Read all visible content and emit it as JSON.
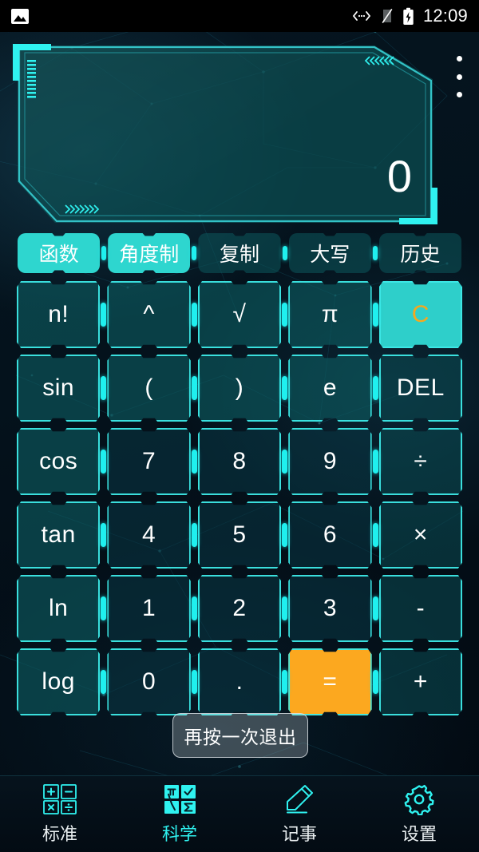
{
  "status_bar": {
    "left_icon": "image-icon",
    "icons": [
      "cast-icon",
      "no-sim-icon",
      "battery-charging-icon"
    ],
    "time": "12:09"
  },
  "display": {
    "value": "0",
    "menu_icon": "overflow-menu-icon",
    "decor": {
      "chevrons_top_right": "《《《",
      "chevrons_bottom_left": "》》》"
    }
  },
  "function_bar": [
    {
      "label": "函数",
      "active": true
    },
    {
      "label": "角度制",
      "active": true
    },
    {
      "label": "复制",
      "active": false
    },
    {
      "label": "大写",
      "active": false
    },
    {
      "label": "历史",
      "active": false
    }
  ],
  "keypad": {
    "rows": [
      [
        {
          "label": "n!",
          "type": "fn"
        },
        {
          "label": "^",
          "type": "fn"
        },
        {
          "label": "√",
          "type": "fn"
        },
        {
          "label": "π",
          "type": "fn"
        },
        {
          "label": "C",
          "type": "clear"
        }
      ],
      [
        {
          "label": "sin",
          "type": "fn"
        },
        {
          "label": "(",
          "type": "fn"
        },
        {
          "label": ")",
          "type": "fn"
        },
        {
          "label": "e",
          "type": "fn"
        },
        {
          "label": "DEL",
          "type": "op"
        }
      ],
      [
        {
          "label": "cos",
          "type": "fn"
        },
        {
          "label": "7",
          "type": "num"
        },
        {
          "label": "8",
          "type": "num"
        },
        {
          "label": "9",
          "type": "num"
        },
        {
          "label": "÷",
          "type": "op"
        }
      ],
      [
        {
          "label": "tan",
          "type": "fn"
        },
        {
          "label": "4",
          "type": "num"
        },
        {
          "label": "5",
          "type": "num"
        },
        {
          "label": "6",
          "type": "num"
        },
        {
          "label": "×",
          "type": "op"
        }
      ],
      [
        {
          "label": "ln",
          "type": "fn"
        },
        {
          "label": "1",
          "type": "num"
        },
        {
          "label": "2",
          "type": "num"
        },
        {
          "label": "3",
          "type": "num"
        },
        {
          "label": "-",
          "type": "op"
        }
      ],
      [
        {
          "label": "log",
          "type": "fn"
        },
        {
          "label": "0",
          "type": "num"
        },
        {
          "label": ".",
          "type": "num"
        },
        {
          "label": "=",
          "type": "equals"
        },
        {
          "label": "+",
          "type": "op"
        }
      ]
    ]
  },
  "toast": {
    "message": "再按一次退出"
  },
  "bottom_nav": [
    {
      "label": "标准",
      "icon": "calculator-grid-icon",
      "active": false
    },
    {
      "label": "科学",
      "icon": "science-grid-icon",
      "active": true
    },
    {
      "label": "记事",
      "icon": "pencil-note-icon",
      "active": false
    },
    {
      "label": "设置",
      "icon": "gear-icon",
      "active": false
    }
  ],
  "colors": {
    "accent_cyan": "#2ff2f0",
    "panel_teal": "#0b4d52",
    "clear_orange": "#f6a81c",
    "equals_orange": "#fca81f",
    "background_dark": "#03101a"
  }
}
